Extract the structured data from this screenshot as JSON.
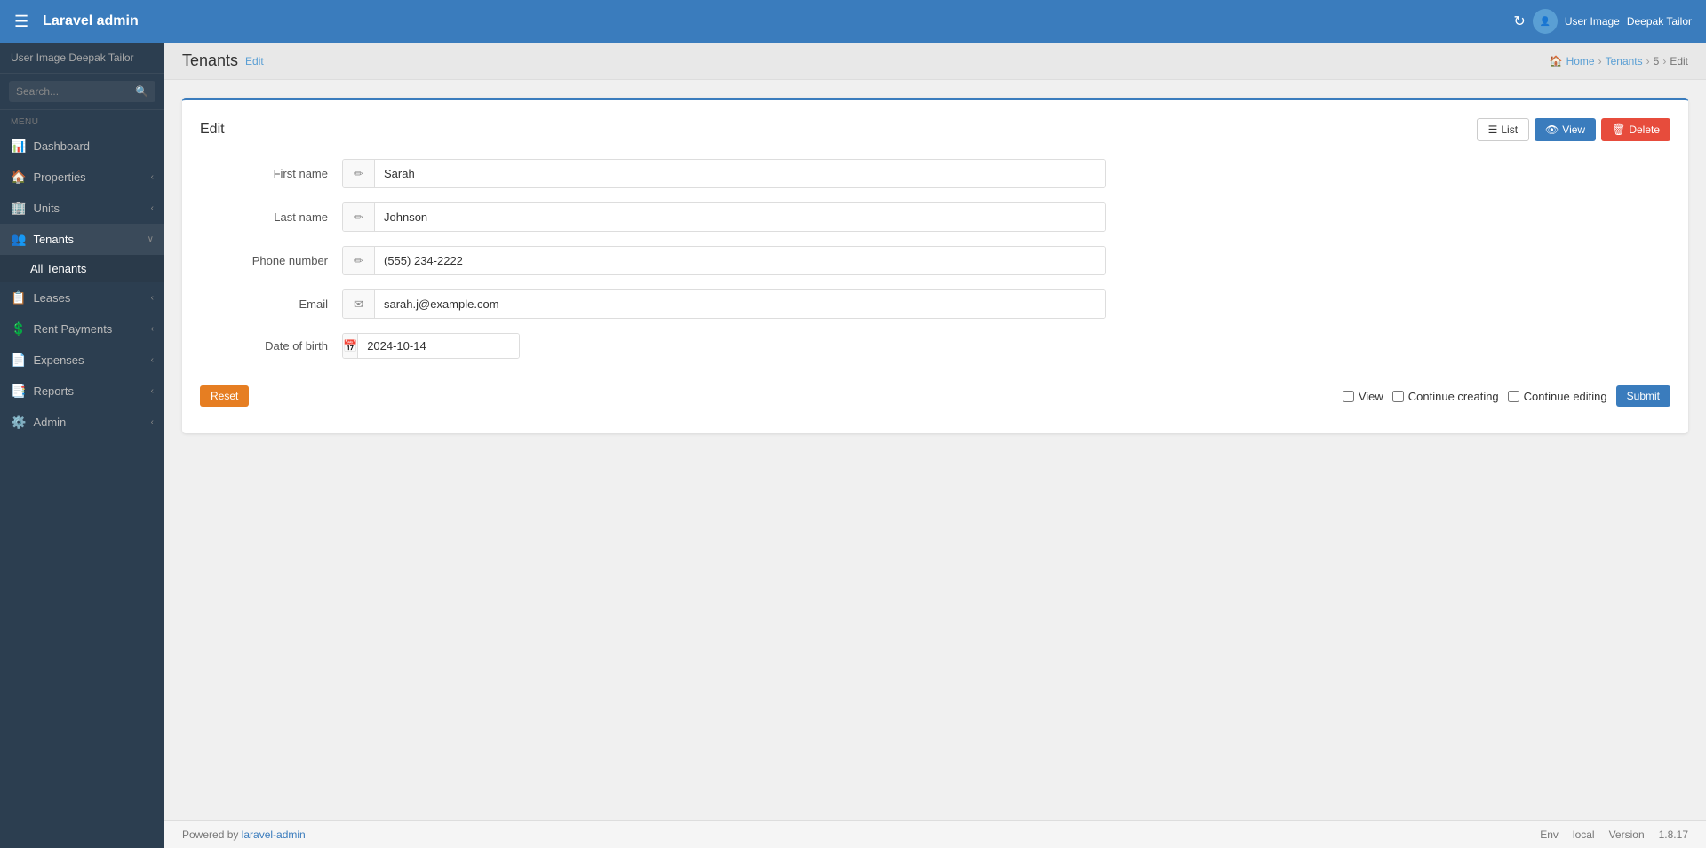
{
  "app": {
    "brand": "Laravel admin",
    "hamburger": "☰"
  },
  "navbar": {
    "refresh_icon": "↻",
    "user_label": "User Image",
    "user_name": "Deepak Tailor"
  },
  "sidebar": {
    "user_label": "User Image",
    "user_name": "Deepak Tailor",
    "search_placeholder": "Search...",
    "menu_label": "Menu",
    "items": [
      {
        "id": "dashboard",
        "icon": "📊",
        "label": "Dashboard",
        "has_arrow": false
      },
      {
        "id": "properties",
        "icon": "🏠",
        "label": "Properties",
        "has_arrow": true
      },
      {
        "id": "units",
        "icon": "🏢",
        "label": "Units",
        "has_arrow": true
      },
      {
        "id": "tenants",
        "icon": "👥",
        "label": "Tenants",
        "has_arrow": true,
        "active": true
      },
      {
        "id": "leases",
        "icon": "📋",
        "label": "Leases",
        "has_arrow": true
      },
      {
        "id": "rent-payments",
        "icon": "💲",
        "label": "Rent Payments",
        "has_arrow": true
      },
      {
        "id": "expenses",
        "icon": "📄",
        "label": "Expenses",
        "has_arrow": true
      },
      {
        "id": "reports",
        "icon": "📑",
        "label": "Reports",
        "has_arrow": true
      },
      {
        "id": "admin",
        "icon": "⚙️",
        "label": "Admin",
        "has_arrow": true
      }
    ],
    "sub_items": [
      {
        "id": "all-tenants",
        "label": "All Tenants",
        "active": true
      }
    ]
  },
  "content_header": {
    "title": "Tenants",
    "edit_label": "Edit"
  },
  "breadcrumb": {
    "home_icon": "🏠",
    "home_label": "Home",
    "tenants_label": "Tenants",
    "id_label": "5",
    "edit_label": "Edit"
  },
  "card": {
    "title": "Edit",
    "btn_list": "List",
    "btn_view": "View",
    "btn_delete": "Delete",
    "list_icon": "☰",
    "view_icon": "👁",
    "delete_icon": "🗑"
  },
  "form": {
    "first_name_label": "First name",
    "first_name_value": "Sarah",
    "first_name_icon": "✏",
    "last_name_label": "Last name",
    "last_name_value": "Johnson",
    "last_name_icon": "✏",
    "phone_label": "Phone number",
    "phone_value": "(555) 234-2222",
    "phone_icon": "✏",
    "email_label": "Email",
    "email_value": "sarah.j@example.com",
    "email_icon": "✉",
    "dob_label": "Date of birth",
    "dob_value": "2024-10-14",
    "dob_icon": "📅",
    "btn_reset": "Reset",
    "btn_view": "View",
    "checkbox_continue_creating": "Continue creating",
    "checkbox_continue_editing": "Continue editing",
    "btn_submit": "Submit"
  },
  "footer": {
    "powered_by": "Powered by ",
    "link_text": "laravel-admin",
    "env_label": "Env",
    "env_value": "local",
    "version_label": "Version",
    "version_value": "1.8.17"
  }
}
